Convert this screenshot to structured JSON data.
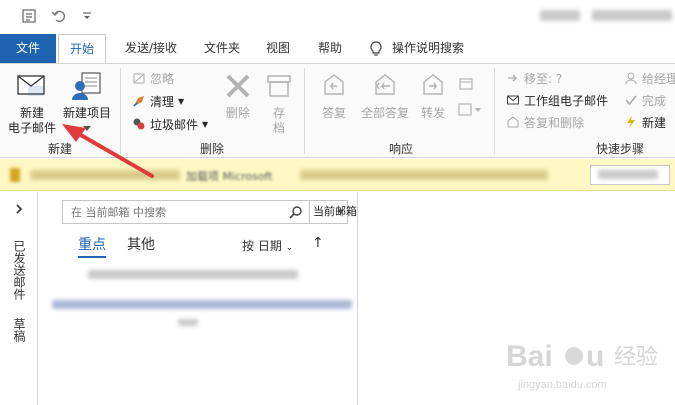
{
  "tabs": {
    "file": "文件",
    "home": "开始",
    "send_receive": "发送/接收",
    "folder": "文件夹",
    "view": "视图",
    "help": "帮助",
    "tell_me": "操作说明搜索"
  },
  "ribbon": {
    "new_group": {
      "label": "新建",
      "new_email_line1": "新建",
      "new_email_line2": "电子邮件",
      "new_items": "新建项目"
    },
    "delete_group": {
      "label": "删除",
      "ignore": "忽略",
      "clean_up": "清理",
      "junk": "垃圾邮件",
      "delete": "删除",
      "archive_line1": "存",
      "archive_line2": "档"
    },
    "respond_group": {
      "label": "响应",
      "reply": "答复",
      "reply_all": "全部答复",
      "forward": "转发"
    },
    "quick_steps_group": {
      "label": "快速步骤",
      "move_to": "移至: ?",
      "team_email": "工作组电子邮件",
      "reply_delete": "答复和删除",
      "to_manager": "给经理",
      "done": "完成",
      "create_new": "新建"
    }
  },
  "infobar": {
    "partial_text": "加载项 Microsoft"
  },
  "nav": {
    "sent_items": "已发送邮件",
    "drafts": "草稿"
  },
  "maillist": {
    "search_placeholder": "在 当前邮箱 中搜索",
    "scope": "当前邮箱",
    "focused": "重点",
    "other": "其他",
    "sort_by": "按 日期",
    "sort_arrow": "↑"
  },
  "colors": {
    "accent": "#1e64b0",
    "file_tab_bg": "#1e64b0",
    "infobar_bg": "#fff8c4",
    "arrow": "#e03a3a"
  }
}
